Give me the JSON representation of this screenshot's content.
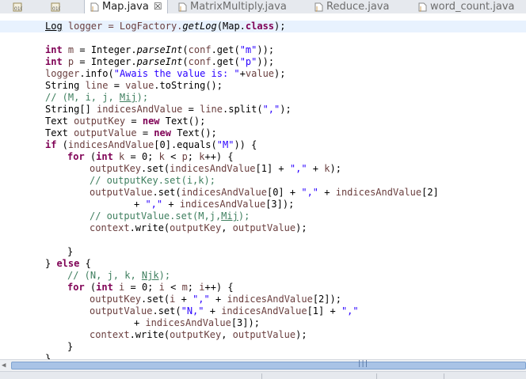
{
  "tabs": [
    {
      "label": "",
      "icon": "class-file-icon",
      "active": false
    },
    {
      "label": "",
      "icon": "class-file-icon",
      "active": false
    },
    {
      "label": "Map.java",
      "icon": "java-file-icon",
      "active": true,
      "close": "☒"
    },
    {
      "label": "MatrixMultiply.java",
      "icon": "java-file-icon",
      "active": false
    },
    {
      "label": "Reduce.java",
      "icon": "java-file-icon",
      "active": false
    },
    {
      "label": "word_count.java",
      "icon": "java-file-icon",
      "active": false
    }
  ],
  "code": {
    "l1": "Log",
    "l1b": " logger = LogFactory.",
    "l1c": "getLog",
    "l1d": "(Map.",
    "l1e": "class",
    "l1f": ");",
    "l2a": "int",
    "l2b": " m",
    "l2c": " = Integer.",
    "l2d": "parseInt",
    "l2e": "(",
    "l2f": "conf",
    "l2g": ".get(",
    "l2h": "\"m\"",
    "l2i": "));",
    "l3a": "int",
    "l3b": " p",
    "l3c": " = Integer.",
    "l3d": "parseInt",
    "l3e": "(",
    "l3f": "conf",
    "l3g": ".get(",
    "l3h": "\"p\"",
    "l3i": "));",
    "l4a": "logger",
    "l4b": ".info(",
    "l4c": "\"Awais the value is: \"",
    "l4d": "+",
    "l4e": "value",
    "l4f": ");",
    "l5a": "String ",
    "l5b": "line",
    "l5c": " = ",
    "l5d": "value",
    "l5e": ".toString();",
    "l6a": "// (M, i, j, ",
    "l6b": "Mij",
    "l6c": ");",
    "l7a": "String[] ",
    "l7b": "indicesAndValue",
    "l7c": " = ",
    "l7d": "line",
    "l7e": ".split(",
    "l7f": "\",\"",
    "l7g": ");",
    "l8a": "Text ",
    "l8b": "outputKey",
    "l8c": " = ",
    "l8d": "new",
    "l8e": " Text();",
    "l9a": "Text ",
    "l9b": "outputValue",
    "l9c": " = ",
    "l9d": "new",
    "l9e": " Text();",
    "l10a": "if",
    "l10b": " (",
    "l10c": "indicesAndValue",
    "l10d": "[0].equals(",
    "l10e": "\"M\"",
    "l10f": ")) {",
    "l11a": "for",
    "l11b": " (",
    "l11c": "int",
    "l11d": " k",
    "l11e": " = 0; ",
    "l11f": "k",
    "l11g": " < ",
    "l11h": "p",
    "l11i": "; ",
    "l11j": "k",
    "l11k": "++) {",
    "l12a": "outputKey",
    "l12b": ".set(",
    "l12c": "indicesAndValue",
    "l12d": "[1] + ",
    "l12e": "\",\"",
    "l12f": " + ",
    "l12g": "k",
    "l12h": ");",
    "l13": "// outputKey.set(i,k);",
    "l14a": "outputValue",
    "l14b": ".set(",
    "l14c": "indicesAndValue",
    "l14d": "[0] + ",
    "l14e": "\",\"",
    "l14f": " + ",
    "l14g": "indicesAndValue",
    "l14h": "[2]",
    "l15a": "+ ",
    "l15b": "\",\"",
    "l15c": " + ",
    "l15d": "indicesAndValue",
    "l15e": "[3]);",
    "l16a": "// outputValue.set(M,j,",
    "l16b": "Mij",
    "l16c": ");",
    "l17a": "context",
    "l17b": ".write(",
    "l17c": "outputKey",
    "l17d": ", ",
    "l17e": "outputValue",
    "l17f": ");",
    "l18": "}",
    "l19a": "} ",
    "l19b": "else",
    "l19c": " {",
    "l20a": "// (N, j, k, ",
    "l20b": "Njk",
    "l20c": ");",
    "l21a": "for",
    "l21b": " (",
    "l21c": "int",
    "l21d": " i",
    "l21e": " = 0; ",
    "l21f": "i",
    "l21g": " < ",
    "l21h": "m",
    "l21i": "; ",
    "l21j": "i",
    "l21k": "++) {",
    "l22a": "outputKey",
    "l22b": ".set(",
    "l22c": "i",
    "l22d": " + ",
    "l22e": "\",\"",
    "l22f": " + ",
    "l22g": "indicesAndValue",
    "l22h": "[2]);",
    "l23a": "outputValue",
    "l23b": ".set(",
    "l23c": "\"N,\"",
    "l23d": " + ",
    "l23e": "indicesAndValue",
    "l23f": "[1] + ",
    "l23g": "\",\"",
    "l24a": "+ ",
    "l24b": "indicesAndValue",
    "l24c": "[3]);",
    "l25a": "context",
    "l25b": ".write(",
    "l25c": "outputKey",
    "l25d": ", ",
    "l25e": "outputValue",
    "l25f": ");",
    "l26": "}",
    "l27": "}"
  },
  "colors": {
    "keyword": "#7f0055",
    "string": "#2a00ff",
    "local_var": "#6a3e3e",
    "field": "#0000c0",
    "comment": "#3f7f5f",
    "current_line": "#e8f2fe"
  },
  "scrollbar": {
    "grip": "|||",
    "left_arrow": "◀"
  }
}
